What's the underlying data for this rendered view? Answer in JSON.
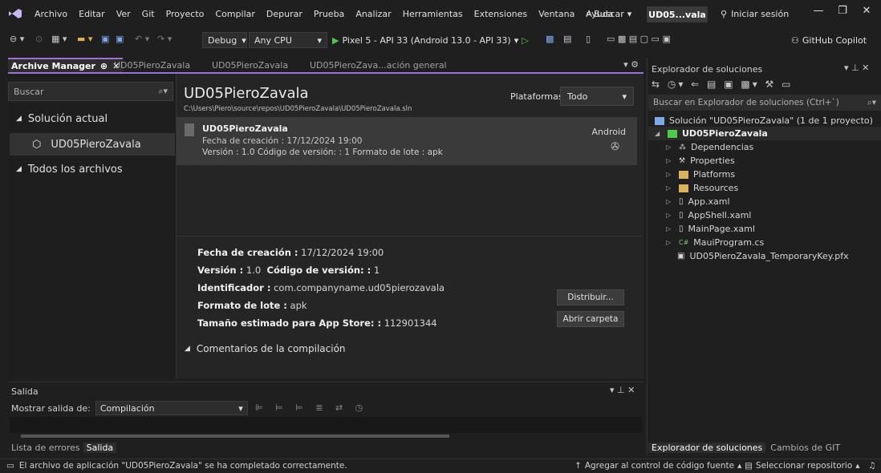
{
  "titlebar": {
    "menu": [
      "Archivo",
      "Editar",
      "Ver",
      "Git",
      "Proyecto",
      "Compilar",
      "Depurar",
      "Prueba",
      "Analizar",
      "Herramientas",
      "Extensiones",
      "Ventana",
      "Ayuda"
    ],
    "search_label": "Buscar",
    "solution_badge": "UD05...vala",
    "signin_label": "Iniciar sesión"
  },
  "toolbar": {
    "config": "Debug",
    "platform": "Any CPU",
    "run_target": "Pixel 5 - API 33 (Android 13.0 - API 33)",
    "copilot_label": "GitHub Copilot"
  },
  "doc_tabs": [
    {
      "label": "Archive Manager"
    },
    {
      "label": "UD05PieroZavala"
    },
    {
      "label": "UD05PieroZavala"
    },
    {
      "label": "UD05PieroZava...ación general"
    }
  ],
  "archive_manager": {
    "search_placeholder": "Buscar",
    "tree": {
      "current_solution": "Solución actual",
      "item": "UD05PieroZavala",
      "all_files": "Todos los archivos"
    },
    "title": "UD05PieroZavala",
    "path": "C:\\Users\\Piero\\source\\repos\\UD05PieroZavala\\UD05PieroZavala.sln",
    "platforms_label": "Plataformas:",
    "platforms_value": "Todo",
    "archive": {
      "name": "UD05PieroZavala",
      "created": "Fecha de creación : 17/12/2024 19:00",
      "version_line": "Versión : 1.0   Código de versión: : 1    Formato de lote : apk",
      "platform": "Android"
    },
    "details": {
      "created_label": "Fecha de creación :",
      "created_value": "17/12/2024 19:00",
      "version_label": "Versión :",
      "version_value": "1.0",
      "code_label": "Código de versión: :",
      "code_value": "1",
      "id_label": "Identificador :",
      "id_value": "com.companyname.ud05pierozavala",
      "format_label": "Formato de lote :",
      "format_value": "apk",
      "size_label": "Tamaño estimado para App Store: :",
      "size_value": "112901344"
    },
    "buttons": {
      "distribute": "Distribuir...",
      "open_folder": "Abrir carpeta"
    },
    "comments_label": "Comentarios de la compilación"
  },
  "output": {
    "title": "Salida",
    "show_from_label": "Mostrar salida de:",
    "show_from_value": "Compilación",
    "tabs": [
      "Lista de errores",
      "Salida"
    ]
  },
  "solution_explorer": {
    "title": "Explorador de soluciones",
    "search_placeholder": "Buscar en Explorador de soluciones (Ctrl+`)",
    "items": [
      {
        "label": "Solución \"UD05PieroZavala\" (1 de 1 proyecto)"
      },
      {
        "label": "UD05PieroZavala"
      },
      {
        "label": "Dependencias"
      },
      {
        "label": "Properties"
      },
      {
        "label": "Platforms"
      },
      {
        "label": "Resources"
      },
      {
        "label": "App.xaml"
      },
      {
        "label": "AppShell.xaml"
      },
      {
        "label": "MainPage.xaml"
      },
      {
        "label": "MauiProgram.cs"
      },
      {
        "label": "UD05PieroZavala_TemporaryKey.pfx"
      }
    ],
    "bottom_tabs": [
      "Explorador de soluciones",
      "Cambios de GIT"
    ]
  },
  "status": {
    "message": "El archivo de aplicación \"UD05PieroZavala\" se ha completado correctamente.",
    "add_source": "Agregar al control de código fuente",
    "select_repo": "Seleccionar repositorio"
  },
  "colors": {
    "accent": "#9a72cf",
    "background": "#1f1f1f",
    "run_green": "#4ec94e"
  }
}
